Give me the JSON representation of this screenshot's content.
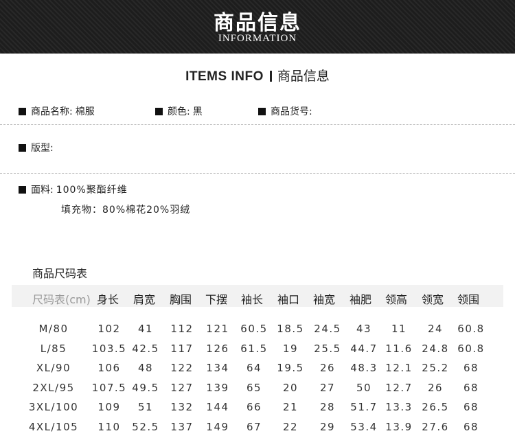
{
  "banner": {
    "title": "商品信息",
    "subtitle": "INFORMATION"
  },
  "section": {
    "title_en": "ITEMS INFO",
    "title_cn": "商品信息"
  },
  "info": {
    "name_label": "商品名称:",
    "name_value": "棉服",
    "color_label": "颜色:",
    "color_value": "黑",
    "sku_label": "商品货号:",
    "fit_label": "版型:",
    "fabric_label": "面料:",
    "fabric_value": "100%聚酯纤维",
    "filling": "填充物：80%棉花20%羽绒"
  },
  "size_table": {
    "title": "商品尺码表",
    "headers": [
      "尺码表(cm)",
      "身长",
      "肩宽",
      "胸围",
      "下摆",
      "袖长",
      "袖口",
      "袖宽",
      "袖肥",
      "领高",
      "领宽",
      "领围"
    ],
    "rows": [
      [
        "M/80",
        "102",
        "41",
        "112",
        "121",
        "60.5",
        "18.5",
        "24.5",
        "43",
        "11",
        "24",
        "60.8"
      ],
      [
        "L/85",
        "103.5",
        "42.5",
        "117",
        "126",
        "61.5",
        "19",
        "25.5",
        "44.7",
        "11.6",
        "24.8",
        "60.8"
      ],
      [
        "XL/90",
        "106",
        "48",
        "122",
        "134",
        "64",
        "19.5",
        "26",
        "48.3",
        "12.1",
        "25.2",
        "68"
      ],
      [
        "2XL/95",
        "107.5",
        "49.5",
        "127",
        "139",
        "65",
        "20",
        "27",
        "50",
        "12.7",
        "26",
        "68"
      ],
      [
        "3XL/100",
        "109",
        "51",
        "132",
        "144",
        "66",
        "21",
        "28",
        "51.7",
        "13.3",
        "26.5",
        "68"
      ],
      [
        "4XL/105",
        "110",
        "52.5",
        "137",
        "149",
        "67",
        "22",
        "29",
        "53.4",
        "13.9",
        "27.6",
        "68"
      ]
    ]
  }
}
